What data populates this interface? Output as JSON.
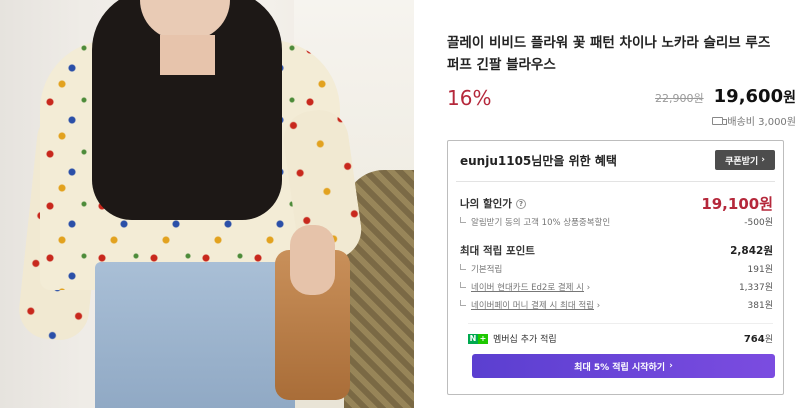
{
  "product": {
    "title_line1": "끌레이 비비드 플라워 꽃 패턴 차이나 노카라 슬리브 루즈",
    "title_line2": "퍼프 긴팔 블라우스",
    "discount_rate": "16%",
    "original_price": "22,900원",
    "sale_price_number": "19,600",
    "sale_price_unit": "원",
    "shipping": "배송비 3,000원"
  },
  "benefits": {
    "heading": "eunju1105님만을 위한 혜택",
    "coupon_button": "쿠폰받기",
    "my_discount_label": "나의 할인가",
    "my_discount_price": "19,100원",
    "alarm_label": "알림받기 동의 고객 10% 상품중복할인",
    "alarm_value": "-500원",
    "max_points_label": "최대 적립 포인트",
    "max_points_value": "2,842원",
    "basic_points_label": "기본적립",
    "basic_points_value": "191원",
    "card_points_label": "네이버 현대카드 Ed2로 결제 시",
    "card_points_value": "1,337원",
    "pay_points_label": "네이버페이 머니 결제 시 최대 적립",
    "pay_points_value": "381원",
    "membership_label": "멤버십 추가 적립",
    "membership_value": "764",
    "membership_unit": "원",
    "cta_label": "최대 5% 적립 시작하기"
  },
  "colors": {
    "accent_red": "#b5283b",
    "cta_purple": "#6a45d8",
    "naver_green": "#1ec800"
  },
  "icons": {
    "question": "question-circle-icon",
    "truck": "truck-icon",
    "chevron": "chevron-right-icon",
    "naver_plus": "naver-plus-badge-icon"
  }
}
